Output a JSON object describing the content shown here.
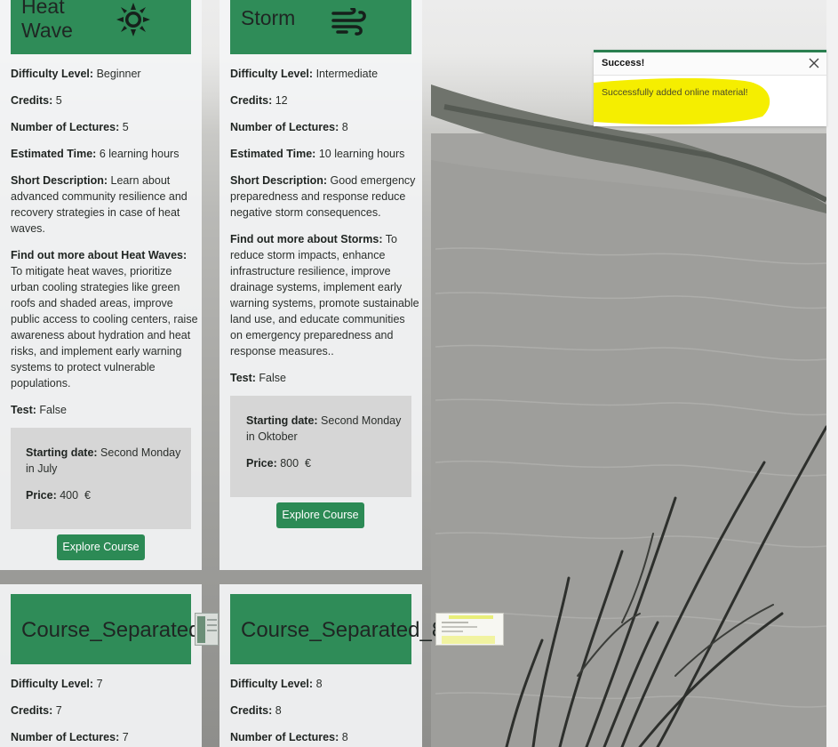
{
  "courses": [
    {
      "title": "Heat\nWave",
      "icon": "sun-icon",
      "difficulty_label": "Difficulty Level:",
      "difficulty": "Beginner",
      "credits_label": "Credits:",
      "credits": "5",
      "lectures_label": "Number of Lectures:",
      "lectures": "5",
      "time_label": "Estimated Time:",
      "time": "6 learning hours",
      "short_desc_label": "Short Description:",
      "short_desc_lines": [
        "Learn about",
        "advanced community resilience and",
        "recovery strategies in case of heat",
        "waves."
      ],
      "more_label": "Find out more about Heat Waves:",
      "more_lines": [
        "To mitigate heat waves, prioritize",
        "urban cooling strategies like green",
        "roofs and shaded areas, improve",
        "public access to cooling centers, raise",
        "awareness about hydration and heat",
        "risks, and implement early warning",
        "systems to protect vulnerable",
        "populations."
      ],
      "test_label": "Test:",
      "test": "False",
      "start_label": "Starting date:",
      "start_line1": "Second Monday",
      "start_line2": "in July",
      "price_label": "Price:",
      "price": "400",
      "currency": "€",
      "button": "Explore Course"
    },
    {
      "title": "Storm",
      "icon": "wind-icon",
      "difficulty_label": "Difficulty Level:",
      "difficulty": "Intermediate",
      "credits_label": "Credits:",
      "credits": "12",
      "lectures_label": "Number of Lectures:",
      "lectures": "8",
      "time_label": "Estimated Time:",
      "time": "10 learning hours",
      "short_desc_label": "Short Description:",
      "short_desc_lines": [
        "Good emergency",
        "preparedness and response reduce",
        "negative storm consequences."
      ],
      "more_label": "Find out more about Storms:",
      "more_lines": [
        "To",
        "reduce storm impacts, enhance",
        "infrastructure resilience, improve",
        "drainage systems, implement early",
        "warning systems, promote sustainable",
        "land use, and educate communities",
        "on emergency preparedness and",
        "response measures.."
      ],
      "test_label": "Test:",
      "test": "False",
      "start_label": "Starting date:",
      "start_line1": "Second Monday",
      "start_line2": "in Oktober",
      "price_label": "Price:",
      "price": "800",
      "currency": "€",
      "button": "Explore Course"
    },
    {
      "title": "Course_Separated",
      "difficulty_label": "Difficulty Level:",
      "difficulty": "7",
      "credits_label": "Credits:",
      "credits": "7",
      "lectures_label": "Number of Lectures:",
      "lectures": "7"
    },
    {
      "title": "Course_Separated_8",
      "difficulty_label": "Difficulty Level:",
      "difficulty": "8",
      "credits_label": "Credits:",
      "credits": "8",
      "lectures_label": "Number of Lectures:",
      "lectures": "8"
    }
  ],
  "toast": {
    "title": "Success!",
    "message": "Successfully added online material!",
    "close_icon": "close-icon",
    "highlight_color": "#f5ee00"
  },
  "colors": {
    "header_green": "#2f8c58",
    "button_green": "#2c8a55"
  }
}
